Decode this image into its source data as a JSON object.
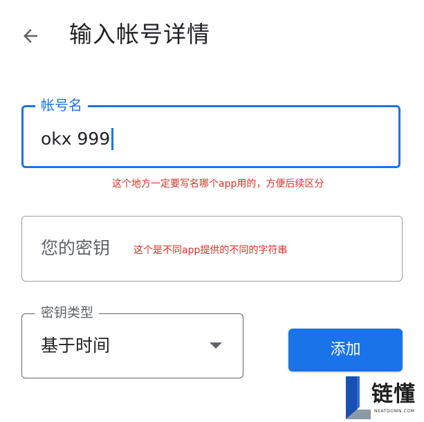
{
  "header": {
    "back_icon": "arrow-left-icon",
    "title": "输入帐号详情"
  },
  "form": {
    "account_name": {
      "label": "帐号名",
      "value": "okx 999",
      "accent_color": "#1a73e8",
      "note": "这个地方一定要写名哪个app用的，方便后续区分"
    },
    "secret_key": {
      "placeholder": "您的密钥",
      "note": "这个是不同app提供的不同的字符串"
    },
    "key_type": {
      "label": "密钥类型",
      "selected": "基于时间",
      "icon": "dropdown-arrow-icon"
    },
    "add_button": {
      "label": "添加",
      "color": "#1a73e8"
    }
  },
  "watermark": {
    "text": "链懂",
    "subtext": "NEATDOWN.COM"
  }
}
